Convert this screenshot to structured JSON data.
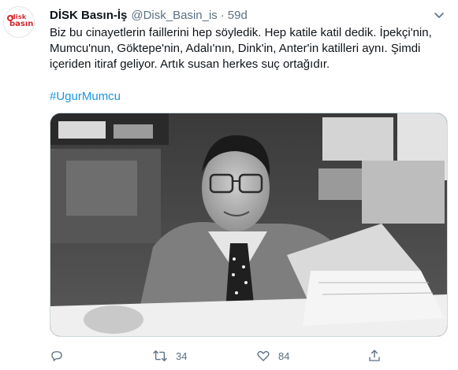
{
  "author": {
    "display_name": "DİSK Basın-İş",
    "handle": "@Disk_Basin_is",
    "separator": "·",
    "time": "59d",
    "avatar_top": "disk",
    "avatar_bottom": "basınİş"
  },
  "tweet": {
    "text": "Biz bu cinayetlerin faillerini hep söyledik. Hep katile katil dedik. İpekçi'nin, Mumcu'nun, Göktepe'nin, Adalı'nın, Dink'in, Anter'in katilleri aynı. Şimdi içeriden itiraf geliyor. Artık susan herkes suç ortağıdır.",
    "hashtag": "#UgurMumcu"
  },
  "media": {
    "type": "black-and-white photo",
    "icon": "photo"
  },
  "actions": {
    "reply_count": "",
    "retweet_count": "34",
    "like_count": "84",
    "share_count": ""
  },
  "colors": {
    "accent": "#1b95e0",
    "muted": "#5b7083",
    "brand_red": "#d7262c"
  }
}
